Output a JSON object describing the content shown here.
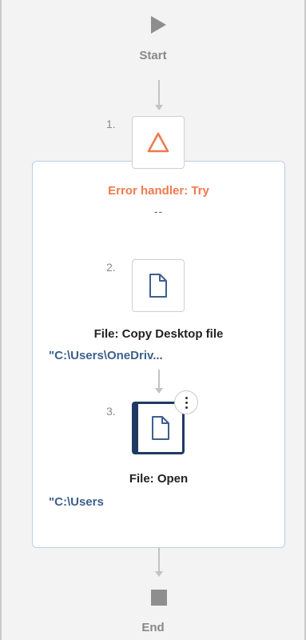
{
  "flow": {
    "start_label": "Start",
    "end_label": "End",
    "error_handler": {
      "title": "Error handler: Try",
      "subtitle": "--"
    },
    "steps": [
      {
        "number": "1.",
        "icon": "warning-triangle-icon"
      },
      {
        "number": "2.",
        "title": "File: Copy Desktop file",
        "param": "\"C:\\Users\\OneDriv...",
        "icon": "file-icon"
      },
      {
        "number": "3.",
        "title": "File: Open",
        "param": "\"C:\\Users",
        "icon": "file-icon"
      }
    ]
  },
  "colors": {
    "accent_error": "#ef7a4e",
    "param_text": "#3e5f8c",
    "selected_border": "#1e3a63",
    "container_border": "#b7d0e6"
  }
}
